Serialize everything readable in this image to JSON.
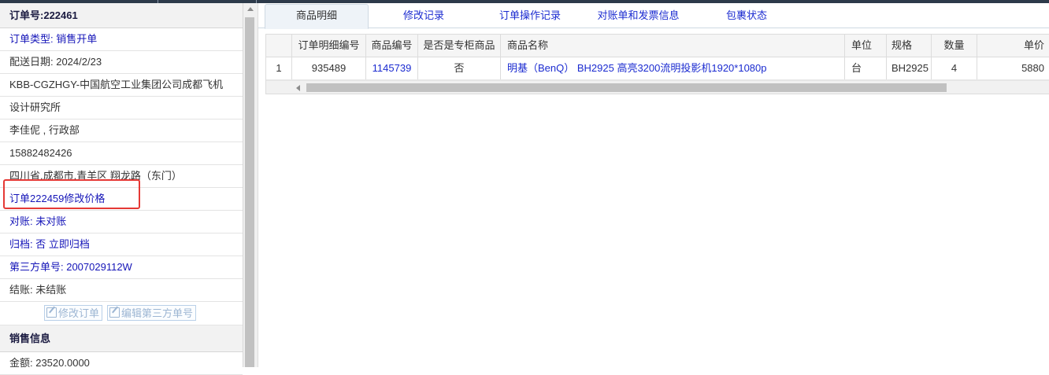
{
  "order": {
    "header_label": "订单号:",
    "number": "222461",
    "type": "订单类型: 销售开单",
    "delivery_date": "配送日期: 2024/2/23",
    "customer_line1": "KBB-CGZHGY-中国航空工业集团公司成都飞机",
    "customer_line2": "设计研究所",
    "contact": "李佳伲 , 行政部",
    "phone": "15882482426",
    "address": "四川省.成都市.青羊区 翔龙路（东门）",
    "price_change_note": "订单222459修改价格",
    "reconcile": "对账: 未对账",
    "archive": "归档:  否 立即归档",
    "third_party_no": "第三方单号: 2007029112W",
    "settlement": "结账: 未结账",
    "buttons": {
      "edit_order": "修改订单",
      "edit_third_party": "编辑第三方单号"
    }
  },
  "sales": {
    "section_title": "销售信息",
    "amount": "金额: 23520.0000"
  },
  "tabs": [
    "商品明细",
    "修改记录",
    "订单操作记录",
    "对账单和发票信息",
    "包裹状态"
  ],
  "grid": {
    "headers": [
      "",
      "订单明细编号",
      "商品编号",
      "是否是专柜商品",
      "商品名称",
      "单位",
      "规格",
      "数量",
      "单价"
    ],
    "rows": [
      [
        "1",
        "935489",
        "1145739",
        "否",
        "明基（BenQ） BH2925 高亮3200流明投影机1920*1080p",
        "台",
        "BH2925",
        "4",
        "5880"
      ]
    ]
  },
  "colors": {
    "link": "#1b2bd0",
    "highlight_box": "#e53935",
    "header_bg": "#f2f2f2"
  }
}
